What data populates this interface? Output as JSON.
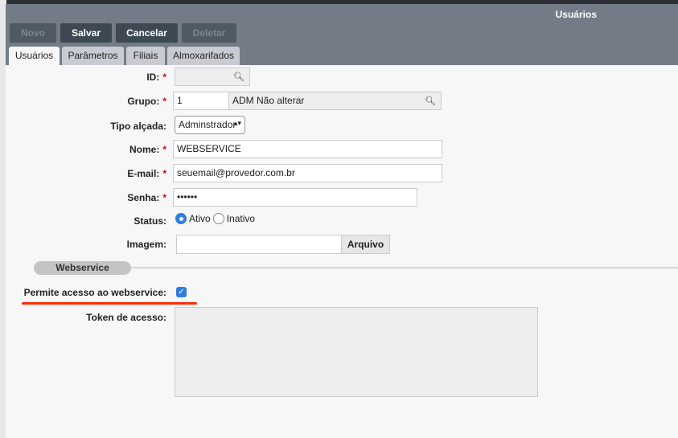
{
  "window": {
    "title": "Usuários"
  },
  "toolbar": {
    "novo": "Novo",
    "salvar": "Salvar",
    "cancelar": "Cancelar",
    "deletar": "Deletar"
  },
  "tabs": [
    "Usuários",
    "Parâmetros",
    "Filiais",
    "Almoxarifados"
  ],
  "form": {
    "id": {
      "label": "ID:",
      "value": ""
    },
    "grupo": {
      "label": "Grupo:",
      "code": "1",
      "name": "ADM Não alterar"
    },
    "tipo": {
      "label": "Tipo alçada:",
      "value": "Adminstrador"
    },
    "nome": {
      "label": "Nome:",
      "value": "WEBSERVICE"
    },
    "email": {
      "label": "E-mail:",
      "value": "seuemail@provedor.com.br"
    },
    "senha": {
      "label": "Senha:",
      "value": "••••••"
    },
    "status": {
      "label": "Status:",
      "options": [
        "Ativo",
        "Inativo"
      ],
      "selected": "Ativo"
    },
    "imagem": {
      "label": "Imagem:",
      "button": "Arquivo"
    },
    "section": "Webservice",
    "permite": {
      "label": "Permite acesso ao webservice:",
      "checked": true
    },
    "token": {
      "label": "Token de acesso:",
      "value": ""
    }
  },
  "colors": {
    "header": "#737c86",
    "button": "#3d4852",
    "accent": "#2f7de1",
    "annotation": "#ff2a00"
  }
}
